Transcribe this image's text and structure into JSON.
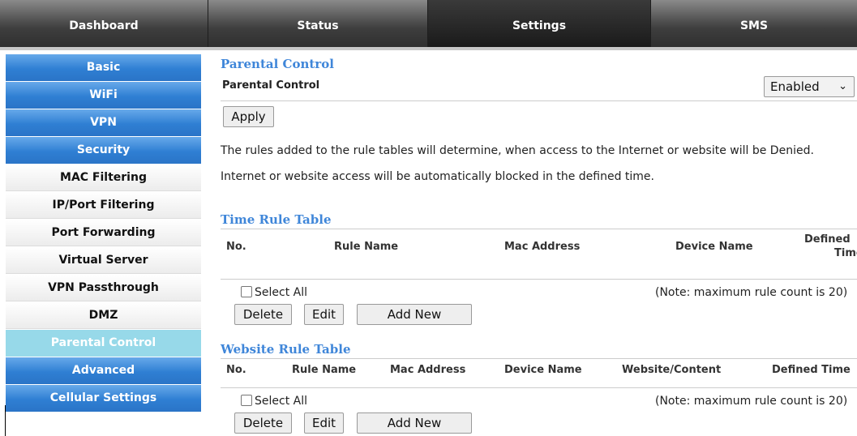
{
  "nav": {
    "tabs": [
      {
        "label": "Dashboard",
        "active": false
      },
      {
        "label": "Status",
        "active": false
      },
      {
        "label": "Settings",
        "active": true
      },
      {
        "label": "SMS",
        "active": false
      }
    ]
  },
  "sidebar": {
    "items": [
      {
        "label": "Basic",
        "type": "main"
      },
      {
        "label": "WiFi",
        "type": "main"
      },
      {
        "label": "VPN",
        "type": "main"
      },
      {
        "label": "Security",
        "type": "main"
      },
      {
        "label": "MAC Filtering",
        "type": "sub"
      },
      {
        "label": "IP/Port Filtering",
        "type": "sub"
      },
      {
        "label": "Port Forwarding",
        "type": "sub"
      },
      {
        "label": "Virtual Server",
        "type": "sub"
      },
      {
        "label": "VPN Passthrough",
        "type": "sub"
      },
      {
        "label": "DMZ",
        "type": "sub"
      },
      {
        "label": "Parental Control",
        "type": "active"
      },
      {
        "label": "Advanced",
        "type": "main"
      },
      {
        "label": "Cellular Settings",
        "type": "main"
      }
    ]
  },
  "main": {
    "section_title": "Parental Control",
    "setting_label": "Parental Control",
    "setting_value": "Enabled",
    "apply_label": "Apply",
    "info_line1": "The rules added to the rule tables will determine, when access to the Internet or website will be Denied.",
    "info_line2": "Internet or website access will be automatically blocked in the defined time.",
    "time_table": {
      "title": "Time Rule Table",
      "columns": [
        "No.",
        "Rule Name",
        "Mac Address",
        "Device Name",
        "Defined",
        "Time"
      ],
      "select_all": "Select All",
      "note": "(Note: maximum rule count is 20)",
      "buttons": {
        "delete": "Delete",
        "edit": "Edit",
        "add": "Add New"
      }
    },
    "website_table": {
      "title": "Website Rule Table",
      "columns": [
        "No.",
        "Rule Name",
        "Mac Address",
        "Device Name",
        "Website/Content",
        "Defined Time"
      ],
      "select_all": "Select All",
      "note": "(Note: maximum rule count is 20)",
      "buttons": {
        "delete": "Delete",
        "edit": "Edit",
        "add": "Add New"
      }
    }
  },
  "colors": {
    "accent_blue": "#3f86d9",
    "sidebar_blue": "#2f7fd3",
    "sidebar_active": "#97d9e9",
    "nav_dark": "#2f2f2f"
  },
  "icons": {
    "select_chevron": "chevron-down-icon"
  }
}
